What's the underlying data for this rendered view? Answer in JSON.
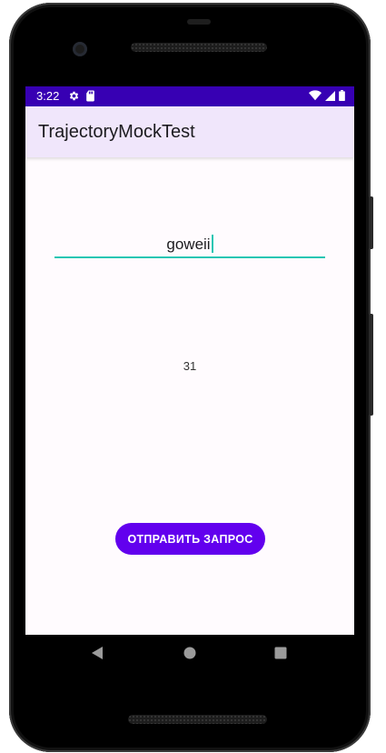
{
  "status_bar": {
    "time": "3:22",
    "background_color": "#3700b3",
    "left_icons": [
      "settings-icon",
      "sd-card-icon"
    ],
    "right_icons": [
      "wifi-icon",
      "signal-icon",
      "battery-icon"
    ]
  },
  "app_bar": {
    "title": "TrajectoryMockTest",
    "background_color": "#f0e6fb"
  },
  "main": {
    "text_field": {
      "value": "goweii",
      "focused": true,
      "accent_color": "#26c6b3"
    },
    "counter_text": "31",
    "send_button": {
      "label": "ОТПРАВИТЬ ЗАПРОС",
      "color": "#6200ee"
    }
  },
  "nav_bar": {
    "buttons": [
      "back-icon",
      "home-icon",
      "recents-icon"
    ]
  }
}
